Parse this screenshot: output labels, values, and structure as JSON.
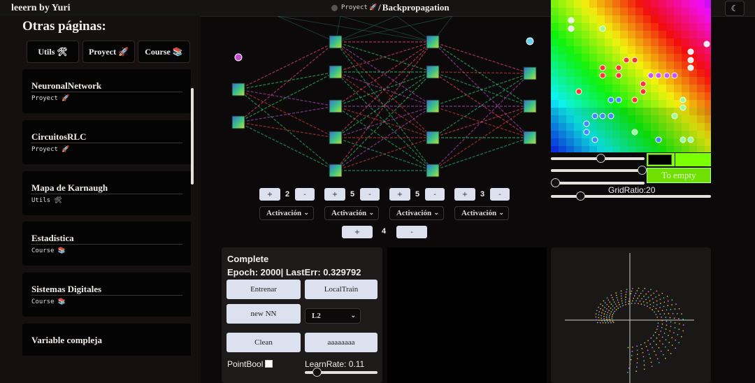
{
  "app": {
    "brand": "leeern by Yuri"
  },
  "breadcrumb": {
    "parent": "Proyect",
    "parent_emoji": "🚀",
    "separator": "/",
    "current": "Backpropagation"
  },
  "theme_icon": "moon-icon",
  "sidebar": {
    "title": "Otras páginas:",
    "chips": [
      {
        "label": "Utils 🛠"
      },
      {
        "label": "Proyect 🚀"
      },
      {
        "label": "Course 📚"
      }
    ],
    "pages": [
      {
        "title": "NeuronalNetwork",
        "tag": "Proyect 🚀"
      },
      {
        "title": "CircuitosRLC",
        "tag": "Proyect 🚀"
      },
      {
        "title": "Mapa de Karnaugh",
        "tag": "Utils 🛠"
      },
      {
        "title": "Estadística",
        "tag": "Course 📚"
      },
      {
        "title": "Sistemas Digitales",
        "tag": "Course 📚"
      },
      {
        "title": "Variable compleja",
        "tag": ""
      }
    ]
  },
  "network": {
    "layers": [
      {
        "plus": "+",
        "count": "2",
        "minus": "-",
        "activation": "Activación"
      },
      {
        "plus": "+",
        "count": "5",
        "minus": "-",
        "activation": "Activación"
      },
      {
        "plus": "+",
        "count": "5",
        "minus": "-",
        "activation": "Activación"
      },
      {
        "plus": "+",
        "count": "3",
        "minus": "-",
        "activation": "Activación"
      }
    ],
    "layer_sizes": [
      2,
      5,
      5,
      3
    ],
    "hidden_layers": {
      "plus": "+",
      "count": "4",
      "minus": "-"
    }
  },
  "controls": {
    "to_empty_label": "To empty",
    "grid_ratio_label": "GridRatio:20",
    "slider1_value": 0.32,
    "slider2_value": 0.58,
    "slider3_value": 0.0,
    "slider4_value": 0.18,
    "color_swatch": "#000000",
    "accent_green": "#7cff00"
  },
  "training": {
    "status": "Complete",
    "epoch_line": "Epoch: 2000| LastErr: 0.329792",
    "train_button": "Entrenar",
    "local_train_button": "LocalTrain",
    "new_nn_button": "new NN",
    "loss_select": "L2",
    "clean_button": "Clean",
    "aaa_button": "aaaaaaaa",
    "point_bool_label": "PointBool",
    "learn_rate_label": "LearnRate: 0.11",
    "learn_rate_value": 0.11
  }
}
